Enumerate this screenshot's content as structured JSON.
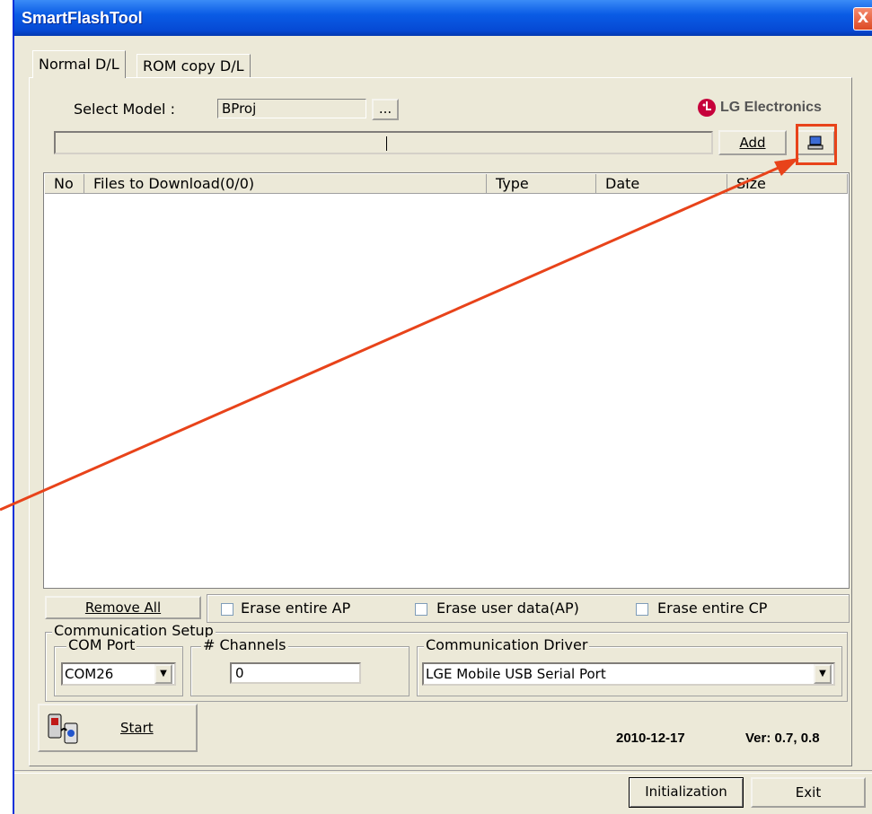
{
  "window": {
    "title": "SmartFlashTool",
    "close_label": "X"
  },
  "tabs": [
    {
      "label": "Normal D/L"
    },
    {
      "label": "ROM copy D/L"
    }
  ],
  "model": {
    "label": "Select Model :",
    "value": "BProj",
    "browse_label": "..."
  },
  "brand": {
    "name": "LG Electronics"
  },
  "file_path": {
    "value": "",
    "add_label": "Add"
  },
  "file_list": {
    "columns": [
      "No",
      "Files to Download(0/0)",
      "Type",
      "Date",
      "Size"
    ],
    "rows": []
  },
  "actions": {
    "remove_all_label": "Remove All"
  },
  "erase_options": [
    {
      "label": "Erase entire AP",
      "checked": false
    },
    {
      "label": "Erase user data(AP)",
      "checked": false
    },
    {
      "label": "Erase entire CP",
      "checked": false
    }
  ],
  "comm_setup": {
    "title": "Communication Setup",
    "com_port": {
      "label": "COM Port",
      "value": "COM26"
    },
    "channels": {
      "label": "# Channels",
      "value": "0"
    },
    "driver": {
      "label": "Communication Driver",
      "value": "LGE Mobile USB Serial Port"
    }
  },
  "start": {
    "label": "Start"
  },
  "footer": {
    "date": "2010-12-17",
    "version": "Ver: 0.7, 0.8",
    "init_label": "Initialization",
    "exit_label": "Exit"
  },
  "annotation": {
    "color": "#e8431a"
  }
}
